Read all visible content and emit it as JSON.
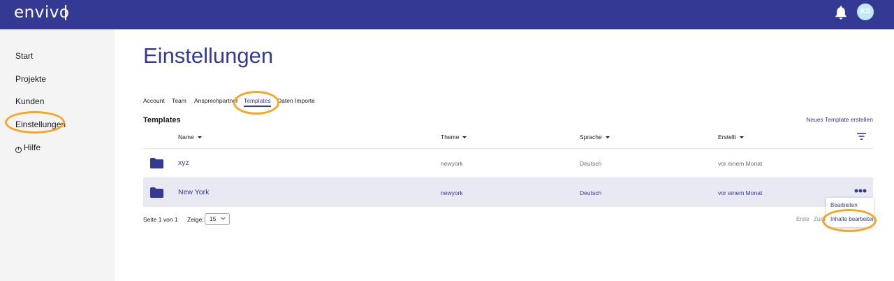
{
  "app": {
    "logo": "envivo",
    "avatar_initials": "KS"
  },
  "sidebar": {
    "items": [
      {
        "label": "Start"
      },
      {
        "label": "Projekte"
      },
      {
        "label": "Kunden"
      },
      {
        "label": "Einstellungen"
      },
      {
        "label": "Hilfe",
        "icon": "help-circle-icon"
      }
    ]
  },
  "page": {
    "title": "Einstellungen"
  },
  "tabs": [
    {
      "label": "Account"
    },
    {
      "label": "Team"
    },
    {
      "label": "Ansprechpartner"
    },
    {
      "label": "Templates",
      "active": true
    },
    {
      "label": "Daten Importe"
    }
  ],
  "section": {
    "title": "Templates",
    "new_link": "Neues Template erstellen"
  },
  "table": {
    "headers": [
      "Name",
      "Theme",
      "Sprache",
      "Erstellt"
    ],
    "rows": [
      {
        "name": "xyz",
        "theme": "newyork",
        "language": "Deutsch",
        "created": "vor einem Monat"
      },
      {
        "name": "New York",
        "theme": "newyork",
        "language": "Deutsch",
        "created": "vor einem Monat",
        "highlighted": true
      }
    ]
  },
  "pagination": {
    "page_info": "Seite 1 von 1",
    "show_label": "Zeige:",
    "page_size": "15",
    "first": "Erste",
    "back_partial": "Zurü"
  },
  "context_menu": {
    "items": [
      "Bearbeiten",
      "Inhalte bearbeiten"
    ]
  },
  "colors": {
    "brand": "#343a94",
    "highlight": "#f5a623",
    "sidebar_bg": "#f4f4f5",
    "row_highlight": "#e8e9f2"
  }
}
